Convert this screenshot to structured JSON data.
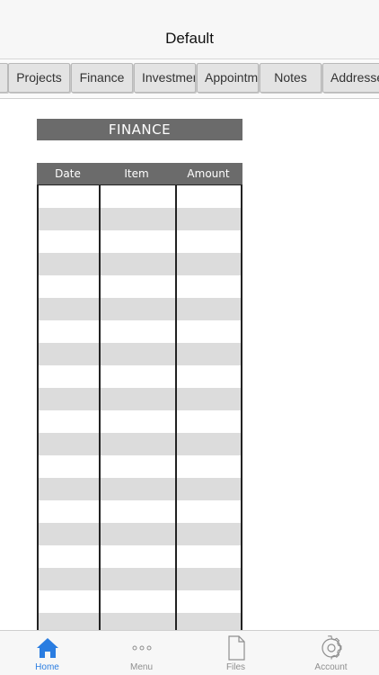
{
  "navbar": {
    "title": "Default"
  },
  "tabs": [
    "",
    "Projects",
    "Finance",
    "Investments",
    "Appointments",
    "Notes",
    "Addresses"
  ],
  "finance": {
    "title": "FINANCE"
  },
  "table": {
    "headers": [
      "Date",
      "Item",
      "Amount"
    ],
    "rows": 20
  },
  "tabbar": {
    "items": [
      {
        "label": "Home",
        "icon": "home-icon",
        "active": true
      },
      {
        "label": "Menu",
        "icon": "more-icon",
        "active": false
      },
      {
        "label": "Files",
        "icon": "file-icon",
        "active": false
      },
      {
        "label": "Account",
        "icon": "gear-icon",
        "active": false
      }
    ]
  },
  "colors": {
    "accent": "#2a7de1",
    "header_gray": "#6b6b6b",
    "row_alt": "#dcdcdc"
  }
}
